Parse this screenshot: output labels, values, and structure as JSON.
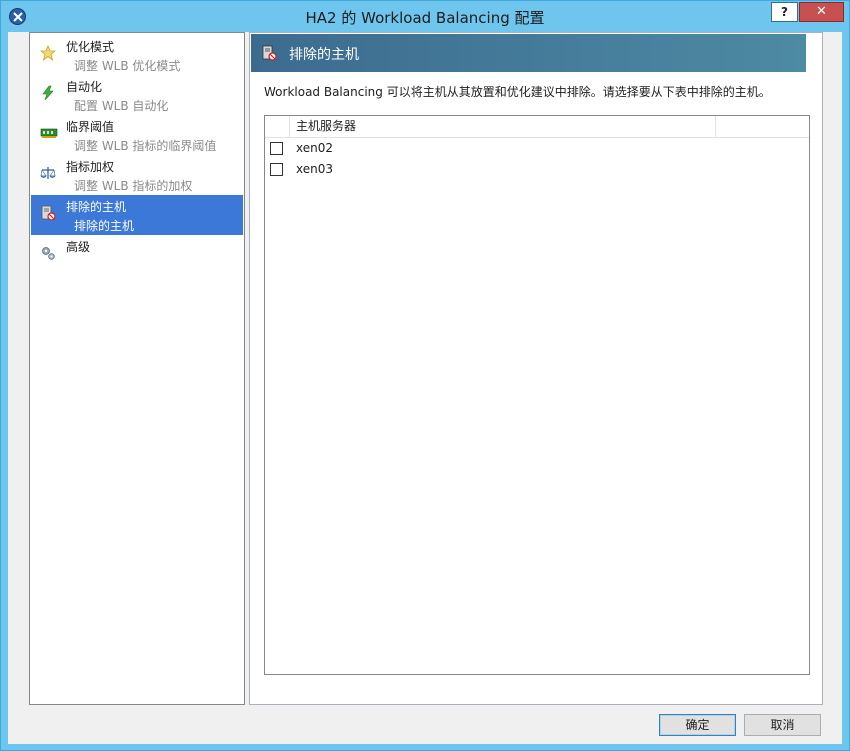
{
  "window": {
    "title": "HA2 的 Workload Balancing 配置",
    "help_label": "?",
    "close_label": "✕"
  },
  "nav": {
    "items": [
      {
        "title": "优化模式",
        "subtitle": "调整 WLB 优化模式",
        "icon": "star-icon"
      },
      {
        "title": "自动化",
        "subtitle": "配置 WLB 自动化",
        "icon": "lightning-icon"
      },
      {
        "title": "临界阈值",
        "subtitle": "调整 WLB 指标的临界阈值",
        "icon": "memory-icon"
      },
      {
        "title": "指标加权",
        "subtitle": "调整 WLB 指标的加权",
        "icon": "scale-icon"
      },
      {
        "title": "排除的主机",
        "subtitle": "排除的主机",
        "icon": "excluded-host-icon"
      },
      {
        "title": "高级",
        "subtitle": "",
        "icon": "gears-icon"
      }
    ],
    "selected_index": 4
  },
  "panel": {
    "title": "排除的主机",
    "description": "Workload Balancing 可以将主机从其放置和优化建议中排除。请选择要从下表中排除的主机。",
    "grid": {
      "column_header": "主机服务器",
      "rows": [
        {
          "name": "xen02",
          "checked": false
        },
        {
          "name": "xen03",
          "checked": false
        }
      ]
    }
  },
  "footer": {
    "ok_label": "确定",
    "cancel_label": "取消"
  },
  "colors": {
    "accent": "#3c78d8",
    "header_gradient_start": "#3c6b8f",
    "header_gradient_end": "#4d8aa3",
    "window_frame": "#6ec6ef"
  }
}
